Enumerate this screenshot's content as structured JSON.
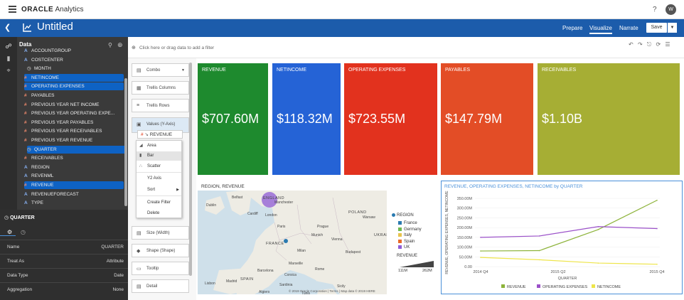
{
  "app": {
    "title": "Analytics",
    "brand": "ORACLE",
    "user_initial": "W",
    "help": "?"
  },
  "project": {
    "title": "Untitled"
  },
  "nav": {
    "tabs": [
      "Prepare",
      "Visualize",
      "Narrate"
    ],
    "save": "Save"
  },
  "data_panel": {
    "label": "Data",
    "items": [
      {
        "label": "ACCOUNTGROUP",
        "type": "a",
        "selected": false
      },
      {
        "label": "COSTCENTER",
        "type": "a",
        "selected": false
      },
      {
        "label": "MONTH",
        "type": "c",
        "selected": false
      },
      {
        "label": "NETINCOME",
        "type": "m",
        "selected": true
      },
      {
        "label": "OPERATING EXPENSES",
        "type": "m",
        "selected": true
      },
      {
        "label": "PAYABLES",
        "type": "m",
        "selected": false
      },
      {
        "label": "PREVIOUS YEAR NET INCOME",
        "type": "m",
        "selected": false
      },
      {
        "label": "PREVIOUS YEAR OPERATING EXPE...",
        "type": "m",
        "selected": false
      },
      {
        "label": "PREVIOUS YEAR PAYABLES",
        "type": "m",
        "selected": false
      },
      {
        "label": "PREVIOUS YEAR RECEIVABLES",
        "type": "m",
        "selected": false
      },
      {
        "label": "PREVIOUS YEAR REVENUE",
        "type": "m",
        "selected": false
      },
      {
        "label": "QUARTER",
        "type": "c",
        "selected": true
      },
      {
        "label": "RECEIVABLES",
        "type": "m",
        "selected": false
      },
      {
        "label": "REGION",
        "type": "a",
        "selected": false
      },
      {
        "label": "REVENML",
        "type": "a",
        "selected": false
      },
      {
        "label": "REVENUE",
        "type": "m",
        "selected": true
      },
      {
        "label": "REVENUEFORECAST",
        "type": "a",
        "selected": false
      },
      {
        "label": "TYPE",
        "type": "a",
        "selected": false
      }
    ]
  },
  "properties": {
    "title": "QUARTER",
    "rows": [
      {
        "k": "Name",
        "v": "QUARTER"
      },
      {
        "k": "Treat As",
        "v": "Attribute"
      },
      {
        "k": "Data Type",
        "v": "Date"
      },
      {
        "k": "Aggregation",
        "v": "None"
      }
    ]
  },
  "filter_bar": {
    "placeholder": "Click here or drag data to add a filter"
  },
  "grammar": {
    "viz_type": "Combo",
    "boxes": [
      "Trellis Columns",
      "Trellis Rows",
      "Values (Y-Axis)",
      "Size (Width)",
      "Shape (Shape)",
      "Tooltip",
      "Detail"
    ],
    "value_chip": "REVENUE"
  },
  "context_menu": {
    "items": [
      "Area",
      "Bar",
      "Scatter",
      "Y2 Axis",
      "Sort",
      "Create Filter",
      "Delete"
    ]
  },
  "tiles": [
    {
      "label": "REVENUE",
      "value": "$707.60M",
      "color": "#1e8a2e"
    },
    {
      "label": "NETINCOME",
      "value": "$118.32M",
      "color": "#2563d6"
    },
    {
      "label": "OPERATING EXPENSES",
      "value": "$723.55M",
      "color": "#e2321e"
    },
    {
      "label": "PAYABLES",
      "value": "$147.79M",
      "color": "#e34d26"
    },
    {
      "label": "RECEIVABLES",
      "value": "$1.10B",
      "color": "#a6ae34"
    }
  ],
  "map": {
    "title": "REGION, REVENUE",
    "labels": [
      "Belfast",
      "Dublin",
      "ENGLAND",
      "Manchester",
      "Cardiff",
      "London",
      "Paris",
      "POLAND",
      "Warsaw",
      "Prague",
      "FRANCE",
      "Munich",
      "Vienna",
      "UKRAINE",
      "Milan",
      "Marseille",
      "Barcelona",
      "SPAIN",
      "Rome",
      "Madrid",
      "Lisbon",
      "Algiers",
      "Tunis",
      "Sicily",
      "Sardinia",
      "Corsica",
      "Budapest"
    ],
    "attribution": "© 2019 Oracle Corporation | Terms | Map data © 2019 HERE",
    "legend_title": "REGION",
    "legend": [
      {
        "name": "France",
        "color": "#2a7ab0"
      },
      {
        "name": "Germany",
        "color": "#6fb94f"
      },
      {
        "name": "Italy",
        "color": "#e8c34a"
      },
      {
        "name": "Spain",
        "color": "#e96a27"
      },
      {
        "name": "UK",
        "color": "#8e5bd6"
      }
    ],
    "size_title": "REVENUE",
    "size_min": "111M",
    "size_max": "262M"
  },
  "chart_data": {
    "type": "line",
    "title": "REVENUE, OPERATING EXPENSES, NETINCOME by QUARTER",
    "xlabel": "QUARTER",
    "ylabel": "REVENUE, OPERATING EXPENSES, NETINCOME",
    "categories": [
      "2014 Q4",
      "2015 Q2",
      "2015 Q4"
    ],
    "x": [
      0,
      2,
      4
    ],
    "y_ticks": [
      "350.00M",
      "300.00M",
      "250.00M",
      "200.00M",
      "150.00M",
      "100.00M",
      "50.00M",
      "0.00"
    ],
    "ylim": [
      0,
      350
    ],
    "series": [
      {
        "name": "REVENUE",
        "color": "#8db33a",
        "values": [
          80,
          82,
          190,
          340
        ]
      },
      {
        "name": "OPERATING EXPENSES",
        "color": "#9b51c9",
        "values": [
          150,
          157,
          205,
          195
        ]
      },
      {
        "name": "NETINCOME",
        "color": "#eee54a",
        "values": [
          47,
          35,
          18,
          12
        ]
      }
    ],
    "series_x": [
      0,
      1,
      2,
      3
    ]
  }
}
